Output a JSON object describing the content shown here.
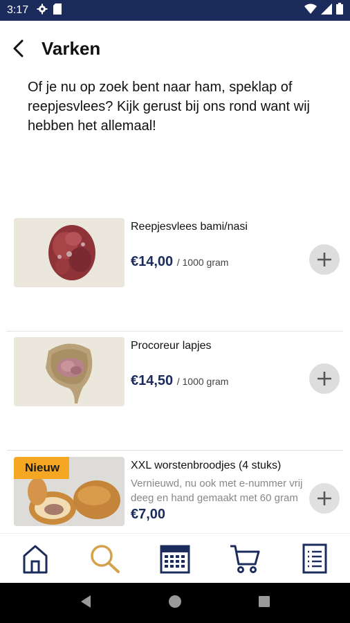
{
  "status": {
    "time": "3:17"
  },
  "header": {
    "title": "Varken"
  },
  "intro": "Of je nu op zoek bent naar ham, speklap of reepjesvlees? Kijk gerust bij ons rond want wij hebben het allemaal!",
  "products": [
    {
      "name": "Reepjesvlees bami/nasi",
      "price": "€14,00",
      "unit": "/ 1000 gram"
    },
    {
      "name": "Procoreur lapjes",
      "price": "€14,50",
      "unit": "/ 1000 gram"
    },
    {
      "name": "XXL worstenbroodjes (4 stuks)",
      "badge": "Nieuw",
      "description": "Vernieuwd, nu ook met e-nummer vrij deeg en hand gemaakt met 60 gram",
      "price": "€7,00"
    }
  ],
  "nav": {
    "items": [
      "home-icon",
      "search-icon",
      "calendar-icon",
      "cart-icon",
      "list-icon"
    ],
    "active": "search-icon"
  },
  "colors": {
    "primary": "#1b2c5c",
    "accent": "#f5a623",
    "active_nav": "#d4a24a"
  }
}
